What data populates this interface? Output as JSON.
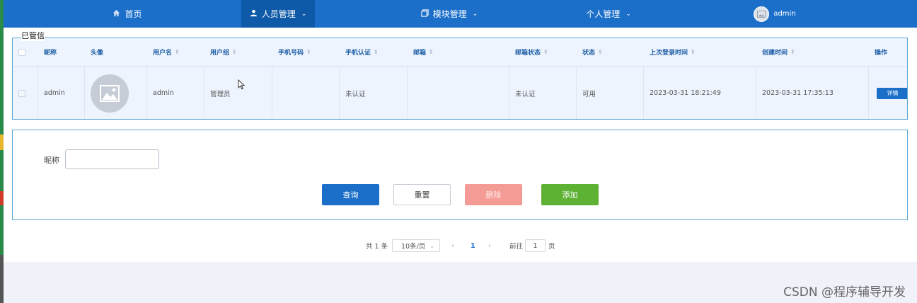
{
  "nav": {
    "home": "首页",
    "personnel": "人员管理",
    "modules": "模块管理",
    "personal": "个人管理",
    "user": "admin"
  },
  "page_label": "已管信",
  "table": {
    "headers": [
      "昵称",
      "头像",
      "用户名",
      "用户组",
      "手机号码",
      "手机认证",
      "邮箱",
      "邮箱状态",
      "状态",
      "上次登录时间",
      "创建时间",
      "操作"
    ],
    "rows": [
      {
        "nickname": "admin",
        "username": "admin",
        "group": "管理员",
        "phone": "",
        "phone_verified": "未认证",
        "email": "",
        "email_status": "未认证",
        "status": "可用",
        "last_login": "2023-03-31 18:21:49",
        "created": "2023-03-31 17:35:13",
        "action": "详情"
      }
    ]
  },
  "search": {
    "label": "昵称",
    "value": "",
    "buttons": {
      "query": "查询",
      "reset": "重置",
      "delete": "删除",
      "add": "添加"
    }
  },
  "pagination": {
    "total": "共 1 条",
    "page_size": "10条/页",
    "current": "1",
    "goto_prefix": "前往",
    "goto_value": "1",
    "goto_suffix": "页"
  },
  "watermark": "CSDN @程序辅导开发",
  "colors": {
    "nav": "#1b6fc9",
    "nav_active": "#0e59a8",
    "query": "#1b6fc9",
    "delete": "#f59b95",
    "add": "#5db133"
  }
}
